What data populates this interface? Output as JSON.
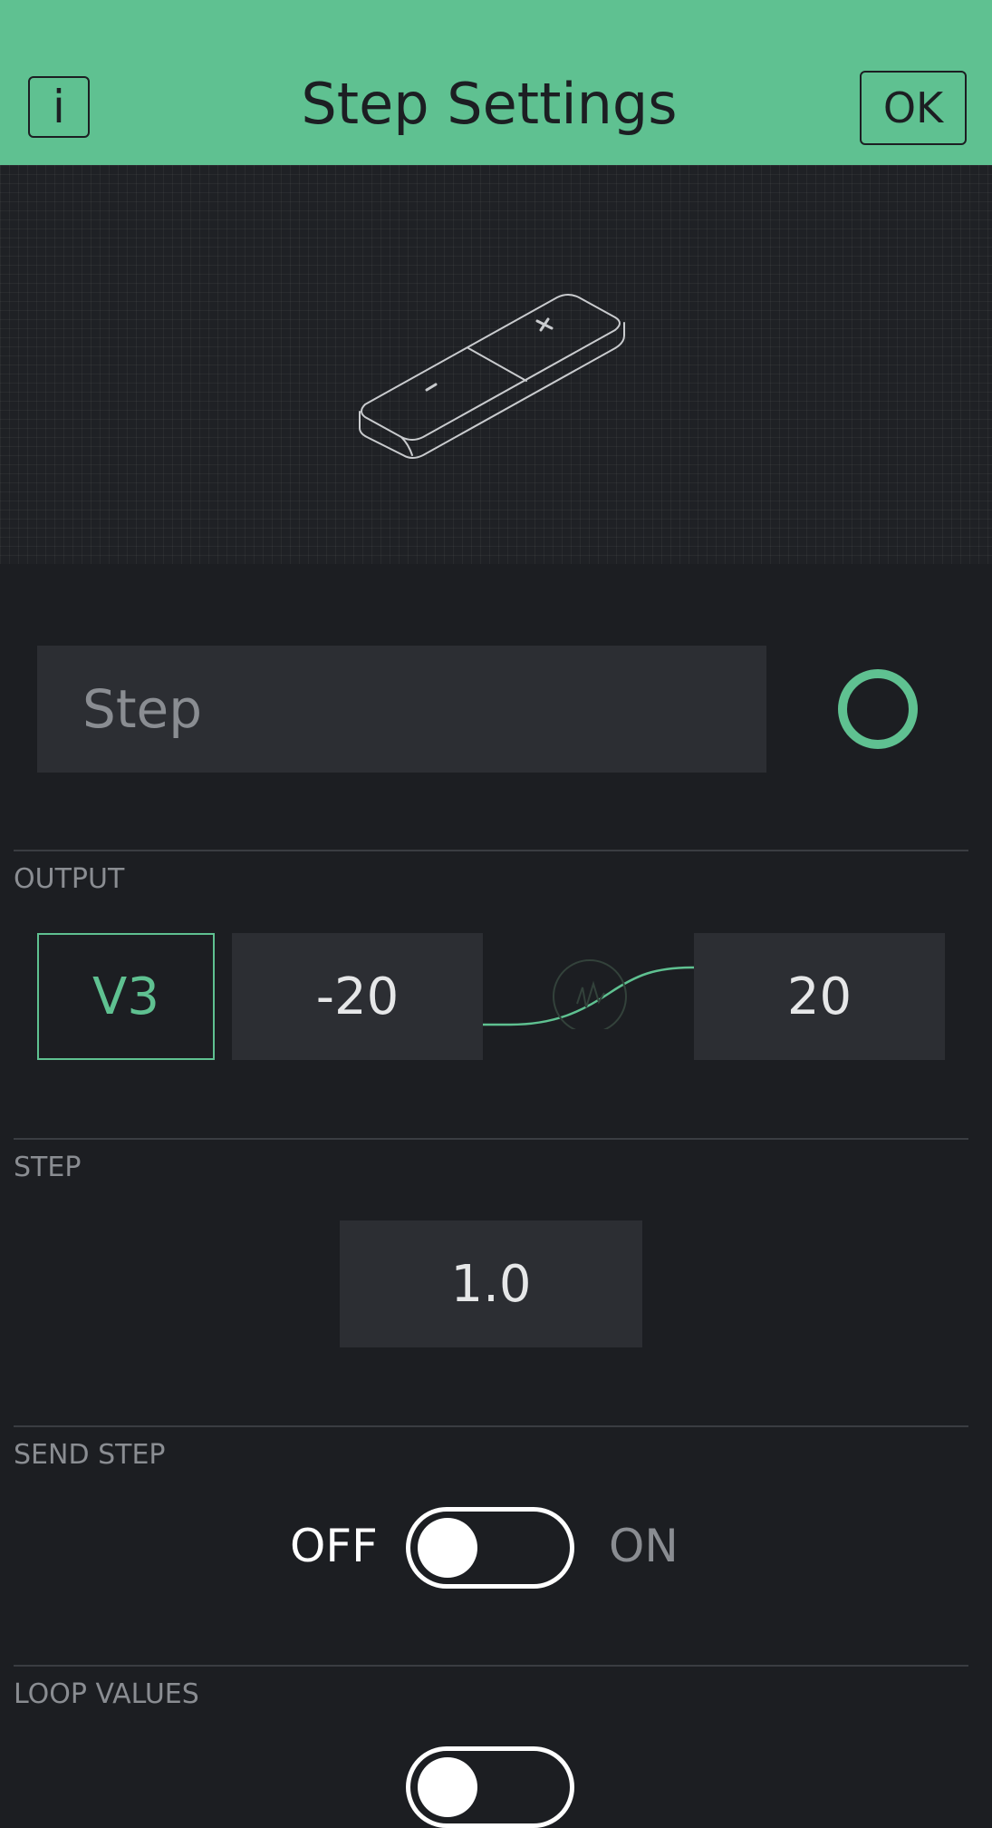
{
  "header": {
    "info_label": "i",
    "title": "Step Settings",
    "ok_label": "OK"
  },
  "widget_name": {
    "placeholder": "Step"
  },
  "output": {
    "section_label": "OUTPUT",
    "pin": "V3",
    "min": "-20",
    "max": "20"
  },
  "step": {
    "section_label": "STEP",
    "value": "1.0"
  },
  "send_step": {
    "section_label": "SEND STEP",
    "off_label": "OFF",
    "on_label": "ON",
    "state": "off"
  },
  "loop_values": {
    "section_label": "LOOP VALUES"
  },
  "colors": {
    "accent": "#5fc191",
    "background": "#1c1e22",
    "field": "#2c2e33"
  }
}
